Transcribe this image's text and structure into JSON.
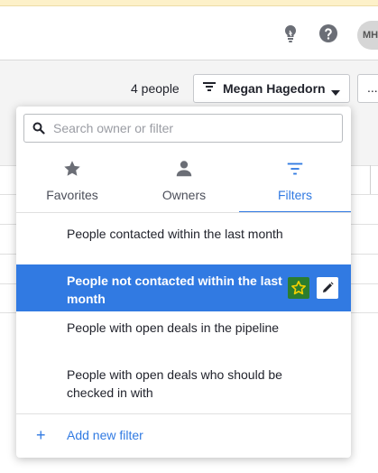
{
  "header": {
    "avatar_initials": "MH",
    "icons": [
      "lightbulb-icon",
      "help-icon"
    ]
  },
  "toolbar": {
    "people_count": "4 people",
    "owner_filter_label": "Megan Hagedorn",
    "more_label": "..."
  },
  "dropdown": {
    "search_placeholder": "Search owner or filter",
    "tabs": [
      {
        "label": "Favorites",
        "icon": "star-icon",
        "active": false
      },
      {
        "label": "Owners",
        "icon": "person-icon",
        "active": false
      },
      {
        "label": "Filters",
        "icon": "filter-icon",
        "active": true
      }
    ],
    "filters": [
      {
        "label": "People contacted within the last month",
        "selected": false
      },
      {
        "label": "People not contacted within the last month",
        "selected": true
      },
      {
        "label": "People with open deals in the pipeline",
        "selected": false
      },
      {
        "label": "People with open deals who should be checked in with",
        "selected": false
      }
    ],
    "add_filter_plus": "+",
    "add_filter_label": "Add new filter"
  },
  "colors": {
    "accent": "#317ae2",
    "favorite_badge": "#2b7d2e",
    "favorite_star": "#f5d000"
  }
}
